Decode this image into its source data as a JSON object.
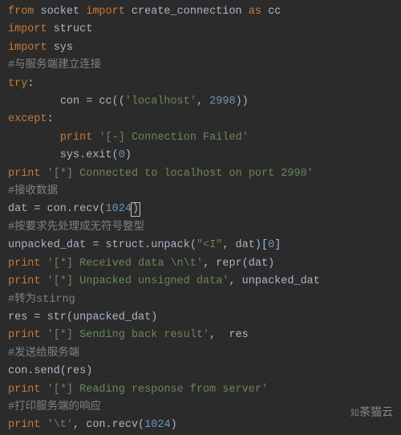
{
  "code": {
    "l1_a": "from",
    "l1_b": " socket ",
    "l1_c": "import",
    "l1_d": " create_connection ",
    "l1_e": "as",
    "l1_f": " cc",
    "l2_a": "import",
    "l2_b": " struct",
    "l3_a": "import",
    "l3_b": " sys",
    "l4": "#与服务端建立连接",
    "l5_a": "try",
    "l5_b": ":",
    "l6_g": "        ",
    "l6_a": "con = cc((",
    "l6_b": "'localhost'",
    "l6_c": ", ",
    "l6_d": "2998",
    "l6_e": "))",
    "l7_a": "except",
    "l7_b": ":",
    "l8_g": "        ",
    "l8_a": "print",
    "l8_b": " ",
    "l8_c": "'[-] Connection Failed'",
    "l9_g": "        ",
    "l9_a": "sys.exit(",
    "l9_b": "0",
    "l9_c": ")",
    "l10_a": "print",
    "l10_b": " ",
    "l10_c": "'[*] Connected to localhost on port 2998'",
    "l11": "#接收数据",
    "l12_a": "dat = con.recv(",
    "l12_b": "1024",
    "l12_c": ")",
    "l13": "#按要求先处理成无符号整型",
    "l14_a": "unpacked_dat = struct.unpack(",
    "l14_b": "\"<I\"",
    "l14_c": ", dat)[",
    "l14_d": "0",
    "l14_e": "]",
    "l15_a": "print",
    "l15_b": " ",
    "l15_c": "'[*] Received data \\n\\t'",
    "l15_d": ", repr(dat)",
    "l16_a": "print",
    "l16_b": " ",
    "l16_c": "'[*] Unpacked unsigned data'",
    "l16_d": ", unpacked_dat",
    "l17": "#转为stirng",
    "l18_a": "res = str(unpacked_dat)",
    "l19_a": "print",
    "l19_b": " ",
    "l19_c": "'[*] Sending back result'",
    "l19_d": ",  res",
    "l20": "#发送给服务端",
    "l21_a": "con.send(res)",
    "l22_a": "print",
    "l22_b": " ",
    "l22_c": "'[*] Reading response from server'",
    "l23": "#打印服务端的响应",
    "l24_a": "print",
    "l24_b": " ",
    "l24_c": "'\\t'",
    "l24_d": ", con.recv(",
    "l24_e": "1024",
    "l24_f": ")"
  },
  "watermark": {
    "pre": "知",
    "main": "茶猫云"
  }
}
